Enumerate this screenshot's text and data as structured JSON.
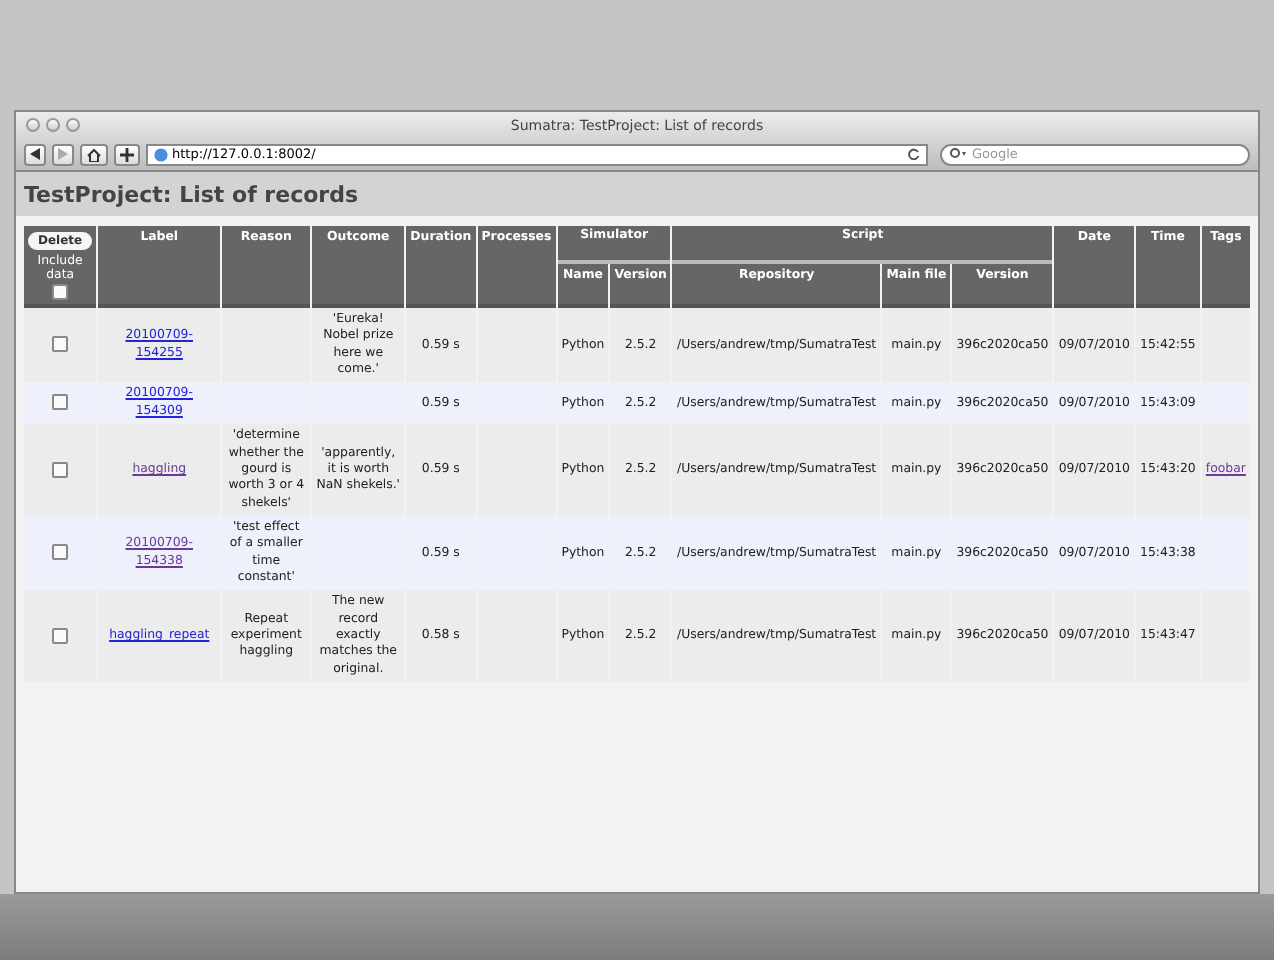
{
  "window": {
    "title": "Sumatra: TestProject: List of records"
  },
  "toolbar": {
    "url": "http://127.0.0.1:8002/",
    "search": {
      "placeholder": "Google"
    }
  },
  "page": {
    "heading": "TestProject: List of records"
  },
  "table": {
    "delete_button": "Delete",
    "include_data": {
      "label": "Include data",
      "checked": false
    },
    "columns": [
      {
        "label": "Label"
      },
      {
        "label": "Reason"
      },
      {
        "label": "Outcome"
      },
      {
        "label": "Duration"
      },
      {
        "label": "Processes"
      },
      {
        "label": "Simulator",
        "children": [
          {
            "label": "Name"
          },
          {
            "label": "Version"
          }
        ]
      },
      {
        "label": "Script",
        "children": [
          {
            "label": "Repository"
          },
          {
            "label": "Main file"
          },
          {
            "label": "Version"
          }
        ]
      },
      {
        "label": "Date"
      },
      {
        "label": "Time"
      },
      {
        "label": "Tags"
      }
    ],
    "rows": [
      {
        "checked": false,
        "label": "20100709-154255",
        "visited": false,
        "reason": "",
        "outcome": "'Eureka! Nobel prize here we come.'",
        "duration": "0.59 s",
        "sim_name": "Python",
        "sim_version": "2.5.2",
        "repository": "/Users/andrew/tmp/SumatraTest",
        "main_file": "main.py",
        "version": "396c2020ca50",
        "date": "09/07/2010",
        "time": "15:42:55",
        "tags": []
      },
      {
        "checked": false,
        "label": "20100709-154309",
        "visited": false,
        "reason": "",
        "outcome": "",
        "duration": "0.59 s",
        "sim_name": "Python",
        "sim_version": "2.5.2",
        "repository": "/Users/andrew/tmp/SumatraTest",
        "main_file": "main.py",
        "version": "396c2020ca50",
        "date": "09/07/2010",
        "time": "15:43:09",
        "tags": []
      },
      {
        "checked": false,
        "label": "haggling",
        "visited": true,
        "reason": "'determine whether the gourd is worth 3 or 4 shekels'",
        "outcome": "'apparently, it is worth NaN shekels.'",
        "duration": "0.59 s",
        "sim_name": "Python",
        "sim_version": "2.5.2",
        "repository": "/Users/andrew/tmp/SumatraTest",
        "main_file": "main.py",
        "version": "396c2020ca50",
        "date": "09/07/2010",
        "time": "15:43:20",
        "tags": [
          {
            "label": "foobar",
            "visited": true
          }
        ]
      },
      {
        "checked": false,
        "label": "20100709-154338",
        "visited": true,
        "reason": "'test effect of a smaller time constant'",
        "outcome": "",
        "duration": "0.59 s",
        "sim_name": "Python",
        "sim_version": "2.5.2",
        "repository": "/Users/andrew/tmp/SumatraTest",
        "main_file": "main.py",
        "version": "396c2020ca50",
        "date": "09/07/2010",
        "time": "15:43:38",
        "tags": []
      },
      {
        "checked": false,
        "label": "haggling_repeat",
        "visited": false,
        "reason": "Repeat experiment haggling",
        "outcome": "The new record exactly matches the original.",
        "duration": "0.58 s",
        "sim_name": "Python",
        "sim_version": "2.5.2",
        "repository": "/Users/andrew/tmp/SumatraTest",
        "main_file": "main.py",
        "version": "396c2020ca50",
        "date": "09/07/2010",
        "time": "15:43:47",
        "tags": []
      }
    ]
  }
}
